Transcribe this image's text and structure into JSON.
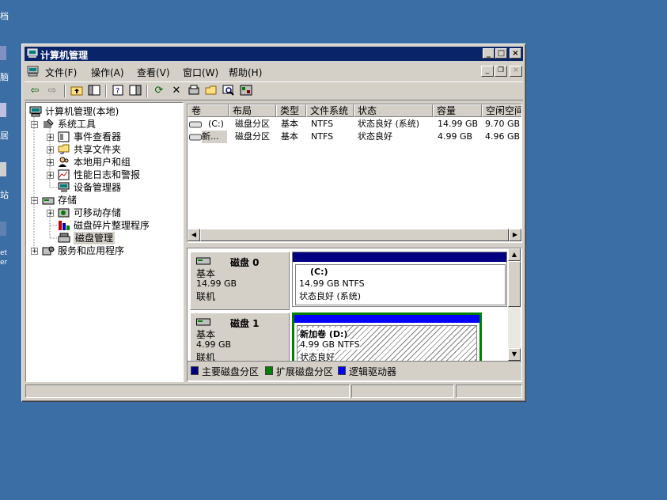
{
  "desktop": {
    "labels": [
      "档",
      "脑",
      "居",
      "站",
      "et",
      "er"
    ]
  },
  "window": {
    "title": "计算机管理",
    "min_glyph": "_",
    "max_glyph": "□",
    "close_glyph": "×"
  },
  "menu": {
    "items": [
      "文件(F)",
      "操作(A)",
      "查看(V)",
      "窗口(W)",
      "帮助(H)"
    ]
  },
  "toolbar": {
    "icons": [
      "back-icon",
      "forward-icon",
      "up-folder-icon",
      "show-hide-tree-icon",
      "properties-icon",
      "help-icon",
      "refresh-icon",
      "delete-icon",
      "disk-properties-icon",
      "open-icon",
      "search-icon",
      "settings-icon"
    ]
  },
  "tree": {
    "root": "计算机管理(本地)",
    "system_tools": "系统工具",
    "event_viewer": "事件查看器",
    "shared_folders": "共享文件夹",
    "local_users": "本地用户和组",
    "perf_logs": "性能日志和警报",
    "device_manager": "设备管理器",
    "storage": "存储",
    "removable": "可移动存储",
    "defrag": "磁盘碎片整理程序",
    "disk_mgmt": "磁盘管理",
    "services": "服务和应用程序"
  },
  "list": {
    "columns": [
      "卷",
      "布局",
      "类型",
      "文件系统",
      "状态",
      "容量",
      "空闲空间"
    ],
    "rows": [
      [
        "(C:)",
        "磁盘分区",
        "基本",
        "NTFS",
        "状态良好 (系统)",
        "14.99 GB",
        "9.70 GB"
      ],
      [
        "新...",
        "磁盘分区",
        "基本",
        "NTFS",
        "状态良好",
        "4.99 GB",
        "4.96 GB"
      ]
    ]
  },
  "disks": [
    {
      "name": "磁盘 0",
      "type": "基本",
      "size": "14.99 GB",
      "state": "联机",
      "volume_label": "(C:)",
      "volume_size": "14.99 GB NTFS",
      "volume_status": "状态良好 (系统)"
    },
    {
      "name": "磁盘 1",
      "type": "基本",
      "size": "4.99 GB",
      "state": "联机",
      "volume_label": "新加卷  (D:)",
      "volume_size": "4.99 GB NTFS",
      "volume_status": "状态良好"
    }
  ],
  "legend": {
    "primary": "主要磁盘分区",
    "extended": "扩展磁盘分区",
    "logical": "逻辑驱动器"
  },
  "colors": {
    "desktop": "#3a6ea5",
    "titlebar": "#0a246a",
    "primary_partition": "#000080",
    "extended_partition": "#008000",
    "logical_drive": "#0000ff"
  }
}
